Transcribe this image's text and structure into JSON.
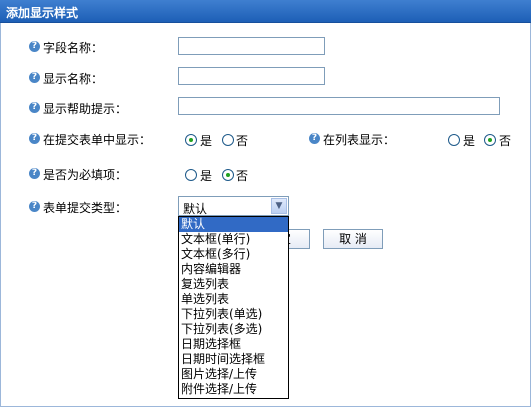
{
  "header": {
    "title": "添加显示样式"
  },
  "help_icon_glyph": "?",
  "fields": {
    "field_name": {
      "label": "字段名称：",
      "value": ""
    },
    "display_name": {
      "label": "显示名称：",
      "value": ""
    },
    "help_text": {
      "label": "显示帮助提示：",
      "value": ""
    },
    "show_in_form": {
      "label": "在提交表单中显示：",
      "yes": "是",
      "no": "否",
      "selected": "yes"
    },
    "show_in_list": {
      "label": "在列表显示：",
      "yes": "是",
      "no": "否",
      "selected": "no"
    },
    "required": {
      "label": "是否为必填项：",
      "yes": "是",
      "no": "否",
      "selected": "no"
    },
    "form_type": {
      "label": "表单提交类型：",
      "selected": "默认",
      "options": [
        "默认",
        "文本框(单行)",
        "文本框(多行)",
        "内容编辑器",
        "复选列表",
        "单选列表",
        "下拉列表(单选)",
        "下拉列表(多选)",
        "日期选择框",
        "日期时间选择框",
        "图片选择/上传",
        "附件选择/上传"
      ]
    }
  },
  "buttons": {
    "confirm_partial": "定",
    "cancel": "取 消"
  },
  "colors": {
    "header_bg": "#2b6cc0",
    "selected_option_bg": "#316ac5",
    "help_icon": "#4a86c7"
  }
}
